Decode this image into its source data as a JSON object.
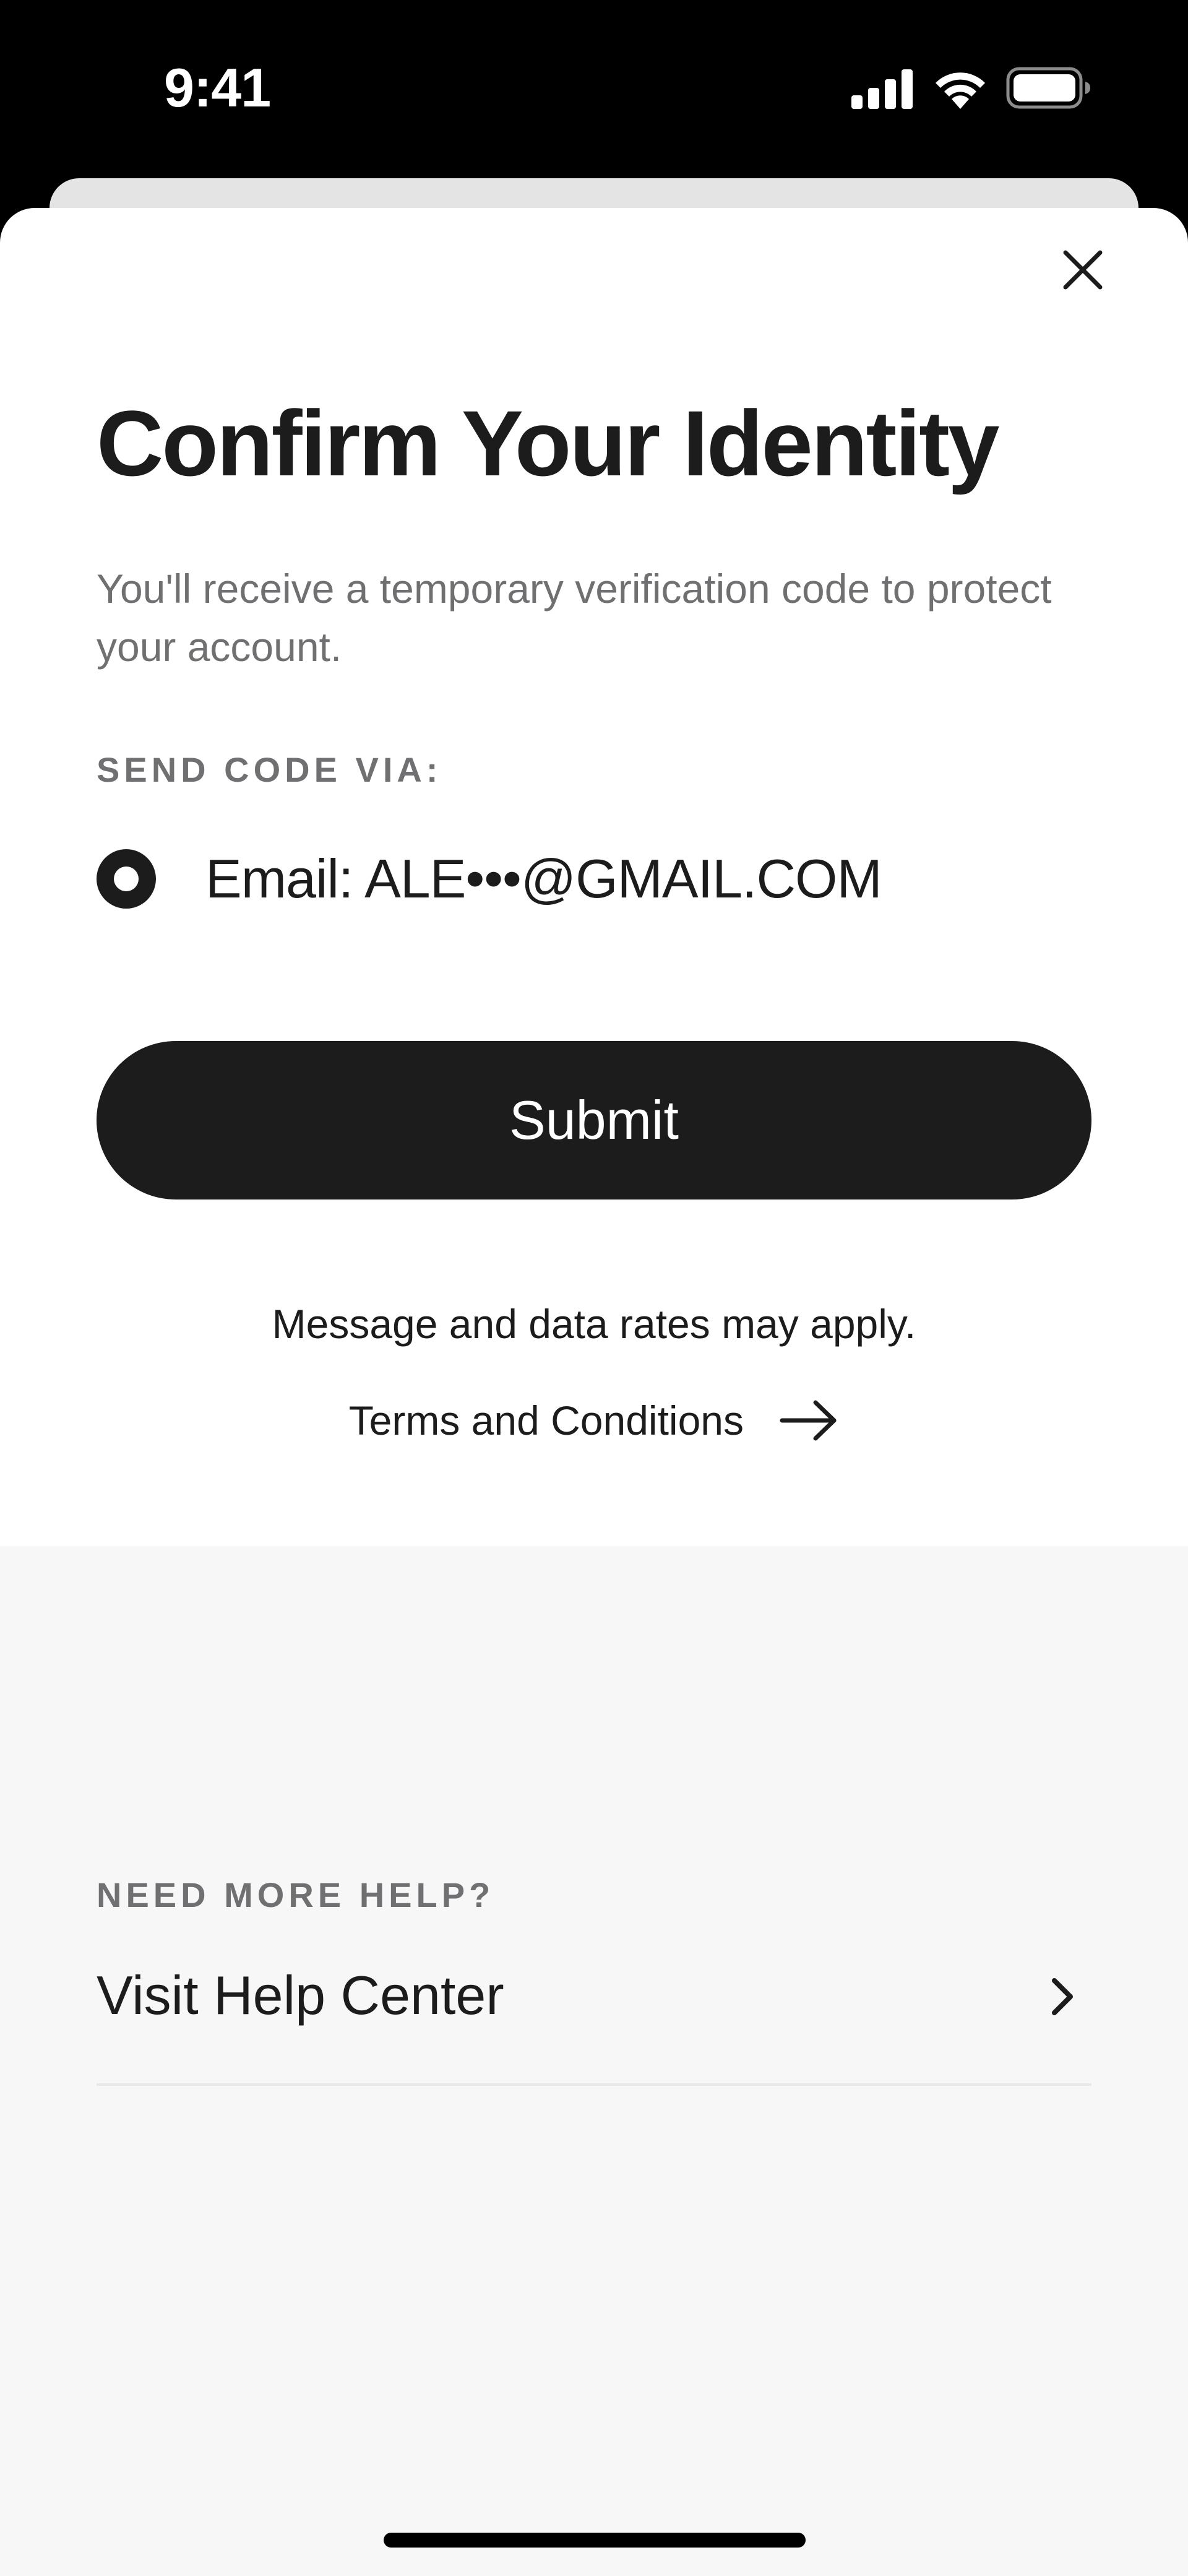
{
  "status_bar": {
    "time": "9:41",
    "icons": [
      "cellular-signal-icon",
      "wifi-icon",
      "battery-icon"
    ]
  },
  "modal": {
    "close_icon": "close-icon",
    "title": "Confirm Your Identity",
    "subtitle": "You'll receive a temporary verification code to protect your account.",
    "send_code_label": "SEND CODE VIA:",
    "options": [
      {
        "label": "Email: ALE•••@GMAIL.COM",
        "selected": true
      }
    ],
    "submit_label": "Submit",
    "rates_note": "Message and data rates may apply.",
    "terms_label": "Terms and Conditions",
    "terms_icon": "arrow-right-icon"
  },
  "help": {
    "label": "NEED MORE HELP?",
    "link_label": "Visit Help Center",
    "link_icon": "chevron-right-icon"
  },
  "colors": {
    "text_primary": "#1c1c1c",
    "text_secondary": "#707072",
    "button_bg": "#1c1c1c",
    "button_text": "#ffffff",
    "help_bg": "#f7f7f7",
    "status_bar_bg": "#000000"
  }
}
